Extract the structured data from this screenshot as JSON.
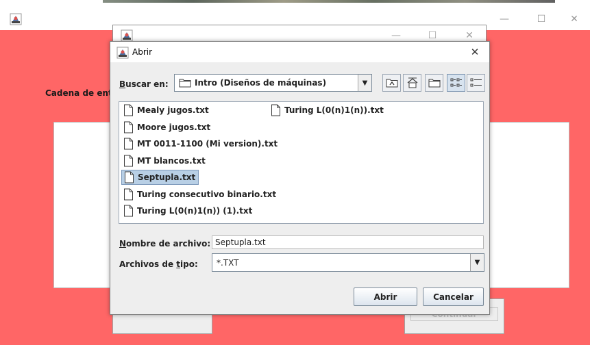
{
  "main_window": {
    "controls": {
      "minimize": "—",
      "maximize": "☐",
      "close": "✕"
    },
    "label": "Cadena de ent",
    "right_button_label": "Continuar"
  },
  "back_dialog": {
    "controls": {
      "minimize": "—",
      "maximize": "☐",
      "close": "✕"
    }
  },
  "dialog": {
    "title": "Abrir",
    "close": "✕",
    "look_in": {
      "label_underline": "B",
      "label_rest": "uscar en:",
      "value": "Intro (Diseños de máquinas)"
    },
    "toolbar_icons": [
      "up-folder-icon",
      "home-icon",
      "new-folder-icon",
      "list-view-icon",
      "details-view-icon"
    ],
    "files": [
      {
        "name": "Mealy jugos.txt",
        "selected": false
      },
      {
        "name": "Moore jugos.txt",
        "selected": false
      },
      {
        "name": "MT 0011-1100 (Mi version).txt",
        "selected": false
      },
      {
        "name": "MT blancos.txt",
        "selected": false
      },
      {
        "name": "Septupla.txt",
        "selected": true
      },
      {
        "name": "Turing consecutivo binario.txt",
        "selected": false
      },
      {
        "name": "Turing L(0(n)1(n)) (1).txt",
        "selected": false
      },
      {
        "name": "Turing L(0(n)1(n)).txt",
        "selected": false
      }
    ],
    "filename": {
      "label_underline": "N",
      "label_rest": "ombre de archivo:",
      "value": "Septupla.txt"
    },
    "filetype": {
      "label_start": "Archivos de ",
      "label_underline": "t",
      "label_end": "ipo:",
      "value": "*.TXT"
    },
    "buttons": {
      "open": "Abrir",
      "cancel": "Cancelar"
    }
  }
}
